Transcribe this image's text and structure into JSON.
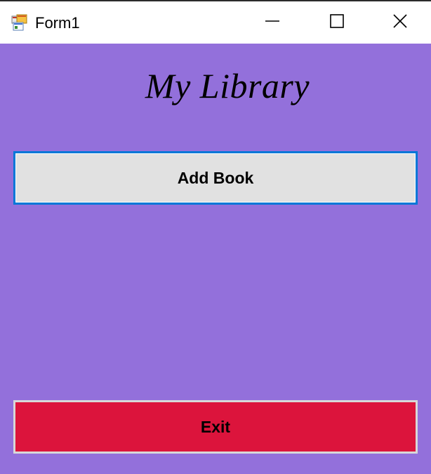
{
  "window": {
    "title": "Form1",
    "icon": "winforms-app-icon",
    "controls": {
      "minimize_icon": "minimize-icon",
      "maximize_icon": "maximize-icon",
      "close_icon": "close-icon"
    }
  },
  "form": {
    "heading": "My Library",
    "add_book_label": "Add Book",
    "exit_label": "Exit"
  },
  "colors": {
    "form_background": "#9370db",
    "add_button_background": "#e1e1e1",
    "add_button_focus_border": "#0078d7",
    "exit_button_background": "#dc143c"
  }
}
